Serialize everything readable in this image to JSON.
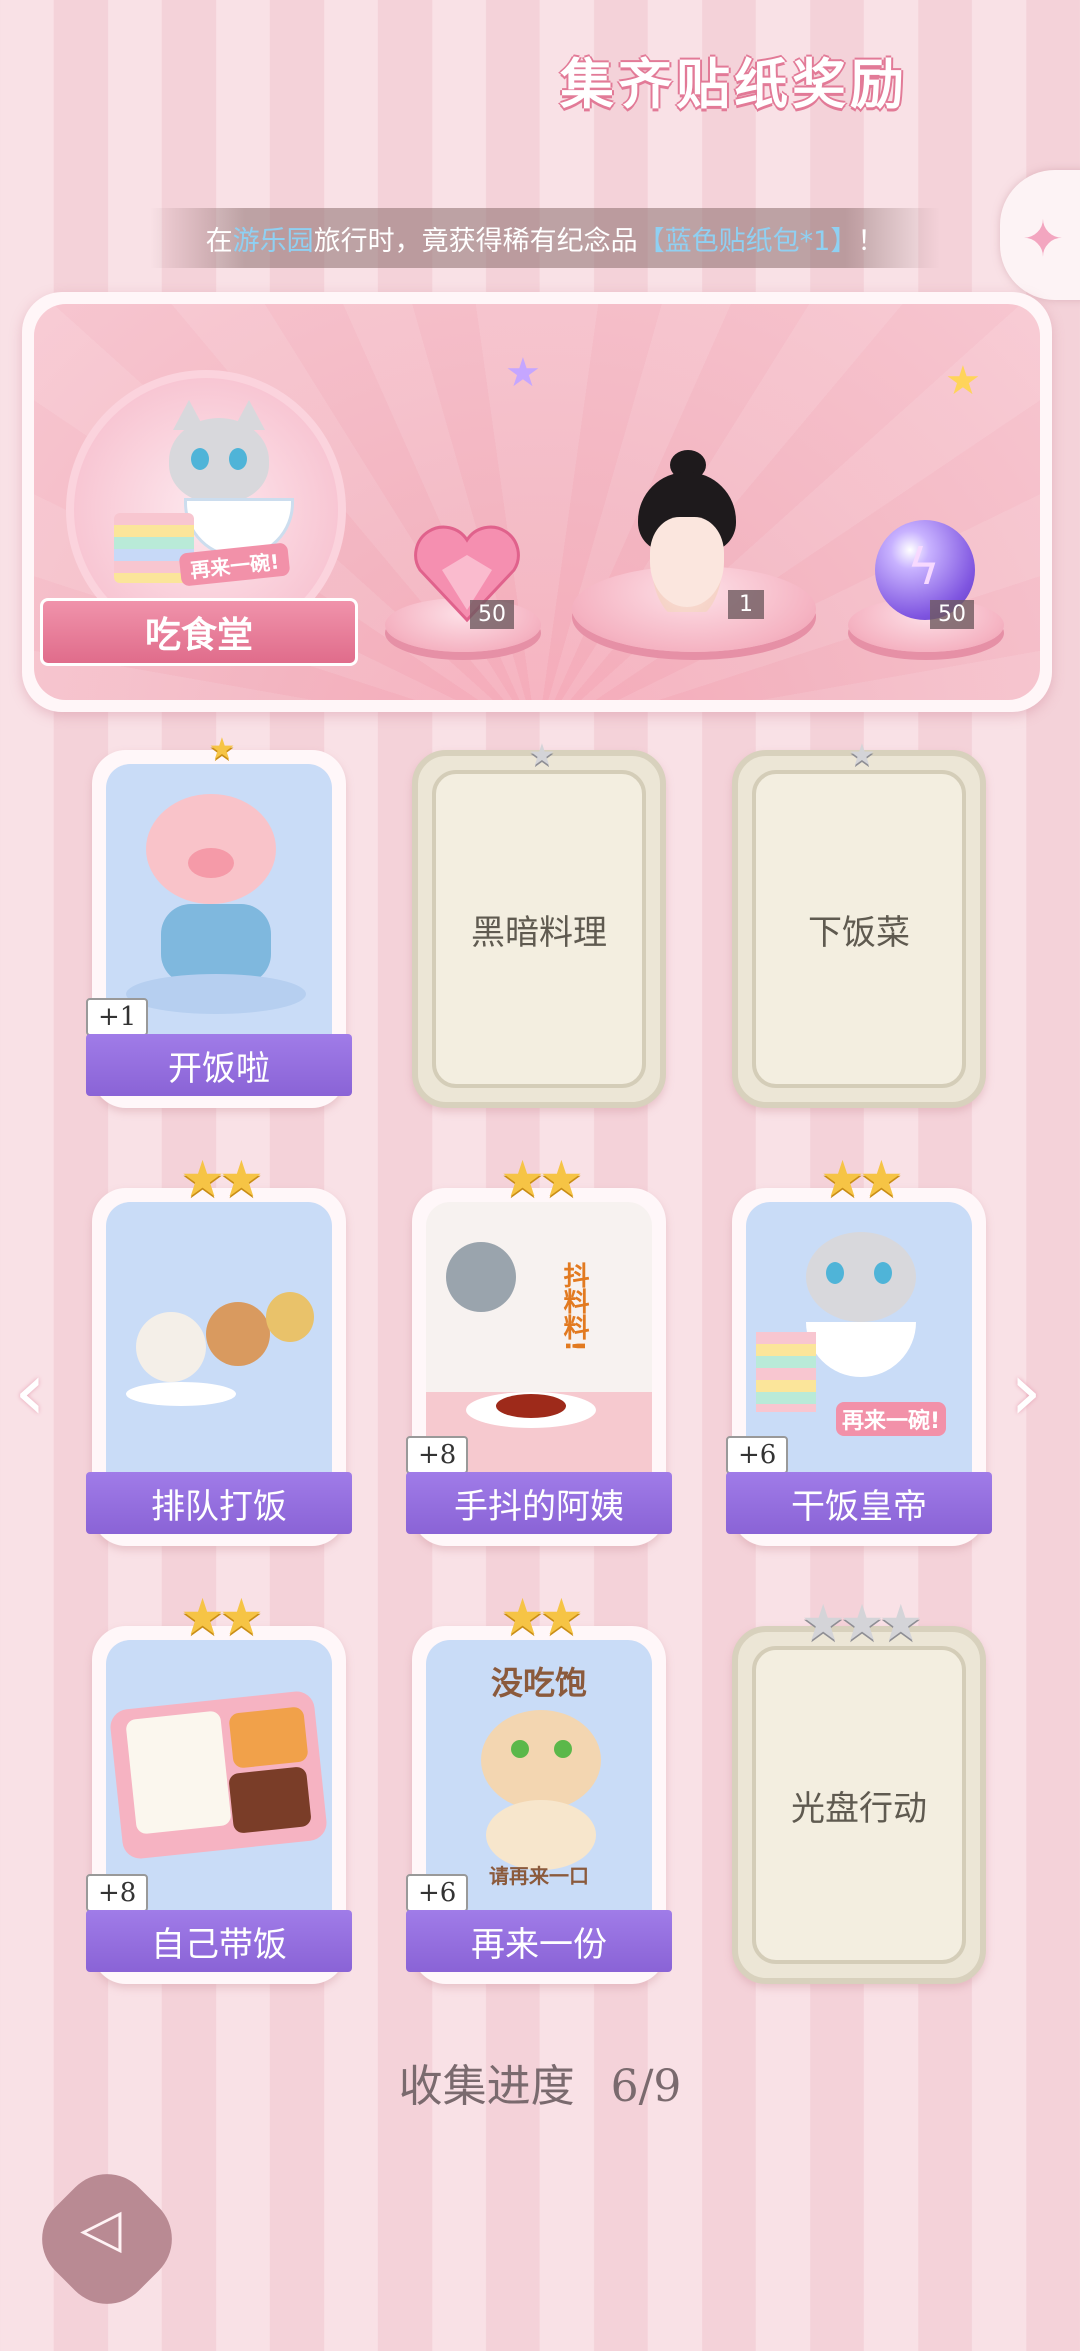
{
  "notice": {
    "prefix": "在",
    "place": "游乐园",
    "middle": "旅行时，竟获得稀有纪念品",
    "item": "【蓝色贴纸包*1】",
    "suffix": "！"
  },
  "panel": {
    "title": "集齐贴纸奖励",
    "shop_name": "吃食堂",
    "shop_ribbon": "再来一碗!",
    "rewards": [
      {
        "icon": "pink-heart-gem-icon",
        "count": "50"
      },
      {
        "icon": "character-portrait",
        "count": "1"
      },
      {
        "icon": "purple-energy-orb-icon",
        "count": "50"
      }
    ]
  },
  "stickers": [
    {
      "name": "开饭啦",
      "count": "+1",
      "stars": "★",
      "collected": true
    },
    {
      "name": "黑暗料理",
      "count": "",
      "stars": "★",
      "collected": false
    },
    {
      "name": "下饭菜",
      "count": "",
      "stars": "★",
      "collected": false
    },
    {
      "name": "排队打饭",
      "count": "",
      "stars": "★★",
      "collected": true
    },
    {
      "name": "手抖的阿姨",
      "count": "+8",
      "stars": "★★",
      "collected": true
    },
    {
      "name": "干饭皇帝",
      "count": "+6",
      "stars": "★★",
      "collected": true
    },
    {
      "name": "自己带饭",
      "count": "+8",
      "stars": "★★",
      "collected": true
    },
    {
      "name": "再来一份",
      "count": "+6",
      "stars": "★★",
      "collected": true
    },
    {
      "name": "光盘行动",
      "count": "",
      "stars": "★★★",
      "collected": false
    }
  ],
  "art_text": {
    "shake": "抖料料!",
    "again_bowl": "再来一碗!",
    "not_full": "没吃饱",
    "one_more": "请再来一口"
  },
  "progress": {
    "label": "收集进度",
    "value": "6/9"
  },
  "nav": {
    "prev": "‹",
    "next": "›"
  },
  "colors": {
    "accent_purple": "#8a63d6",
    "star_gold": "#f6c445",
    "highlight_blue": "#8fd0f2"
  }
}
